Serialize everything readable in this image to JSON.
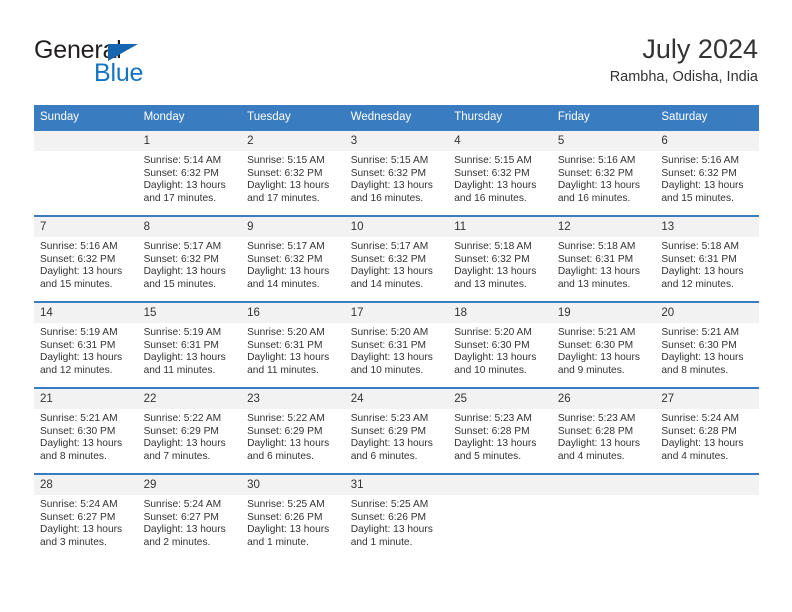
{
  "brand": {
    "name_part1": "General",
    "name_part2": "Blue"
  },
  "header": {
    "title": "July 2024",
    "subtitle": "Rambha, Odisha, India"
  },
  "colors": {
    "header_blue": "#3a7cc0",
    "brand_blue": "#1474c4",
    "daynum_band": "#f2f2f2",
    "text": "#333333"
  },
  "weekday_headers": [
    "Sunday",
    "Monday",
    "Tuesday",
    "Wednesday",
    "Thursday",
    "Friday",
    "Saturday"
  ],
  "weeks": [
    [
      {
        "day": "",
        "empty": true,
        "sunrise": "",
        "sunset": "",
        "daylight1": "",
        "daylight2": ""
      },
      {
        "day": "1",
        "sunrise": "Sunrise: 5:14 AM",
        "sunset": "Sunset: 6:32 PM",
        "daylight1": "Daylight: 13 hours",
        "daylight2": "and 17 minutes."
      },
      {
        "day": "2",
        "sunrise": "Sunrise: 5:15 AM",
        "sunset": "Sunset: 6:32 PM",
        "daylight1": "Daylight: 13 hours",
        "daylight2": "and 17 minutes."
      },
      {
        "day": "3",
        "sunrise": "Sunrise: 5:15 AM",
        "sunset": "Sunset: 6:32 PM",
        "daylight1": "Daylight: 13 hours",
        "daylight2": "and 16 minutes."
      },
      {
        "day": "4",
        "sunrise": "Sunrise: 5:15 AM",
        "sunset": "Sunset: 6:32 PM",
        "daylight1": "Daylight: 13 hours",
        "daylight2": "and 16 minutes."
      },
      {
        "day": "5",
        "sunrise": "Sunrise: 5:16 AM",
        "sunset": "Sunset: 6:32 PM",
        "daylight1": "Daylight: 13 hours",
        "daylight2": "and 16 minutes."
      },
      {
        "day": "6",
        "sunrise": "Sunrise: 5:16 AM",
        "sunset": "Sunset: 6:32 PM",
        "daylight1": "Daylight: 13 hours",
        "daylight2": "and 15 minutes."
      }
    ],
    [
      {
        "day": "7",
        "sunrise": "Sunrise: 5:16 AM",
        "sunset": "Sunset: 6:32 PM",
        "daylight1": "Daylight: 13 hours",
        "daylight2": "and 15 minutes."
      },
      {
        "day": "8",
        "sunrise": "Sunrise: 5:17 AM",
        "sunset": "Sunset: 6:32 PM",
        "daylight1": "Daylight: 13 hours",
        "daylight2": "and 15 minutes."
      },
      {
        "day": "9",
        "sunrise": "Sunrise: 5:17 AM",
        "sunset": "Sunset: 6:32 PM",
        "daylight1": "Daylight: 13 hours",
        "daylight2": "and 14 minutes."
      },
      {
        "day": "10",
        "sunrise": "Sunrise: 5:17 AM",
        "sunset": "Sunset: 6:32 PM",
        "daylight1": "Daylight: 13 hours",
        "daylight2": "and 14 minutes."
      },
      {
        "day": "11",
        "sunrise": "Sunrise: 5:18 AM",
        "sunset": "Sunset: 6:32 PM",
        "daylight1": "Daylight: 13 hours",
        "daylight2": "and 13 minutes."
      },
      {
        "day": "12",
        "sunrise": "Sunrise: 5:18 AM",
        "sunset": "Sunset: 6:31 PM",
        "daylight1": "Daylight: 13 hours",
        "daylight2": "and 13 minutes."
      },
      {
        "day": "13",
        "sunrise": "Sunrise: 5:18 AM",
        "sunset": "Sunset: 6:31 PM",
        "daylight1": "Daylight: 13 hours",
        "daylight2": "and 12 minutes."
      }
    ],
    [
      {
        "day": "14",
        "sunrise": "Sunrise: 5:19 AM",
        "sunset": "Sunset: 6:31 PM",
        "daylight1": "Daylight: 13 hours",
        "daylight2": "and 12 minutes."
      },
      {
        "day": "15",
        "sunrise": "Sunrise: 5:19 AM",
        "sunset": "Sunset: 6:31 PM",
        "daylight1": "Daylight: 13 hours",
        "daylight2": "and 11 minutes."
      },
      {
        "day": "16",
        "sunrise": "Sunrise: 5:20 AM",
        "sunset": "Sunset: 6:31 PM",
        "daylight1": "Daylight: 13 hours",
        "daylight2": "and 11 minutes."
      },
      {
        "day": "17",
        "sunrise": "Sunrise: 5:20 AM",
        "sunset": "Sunset: 6:31 PM",
        "daylight1": "Daylight: 13 hours",
        "daylight2": "and 10 minutes."
      },
      {
        "day": "18",
        "sunrise": "Sunrise: 5:20 AM",
        "sunset": "Sunset: 6:30 PM",
        "daylight1": "Daylight: 13 hours",
        "daylight2": "and 10 minutes."
      },
      {
        "day": "19",
        "sunrise": "Sunrise: 5:21 AM",
        "sunset": "Sunset: 6:30 PM",
        "daylight1": "Daylight: 13 hours",
        "daylight2": "and 9 minutes."
      },
      {
        "day": "20",
        "sunrise": "Sunrise: 5:21 AM",
        "sunset": "Sunset: 6:30 PM",
        "daylight1": "Daylight: 13 hours",
        "daylight2": "and 8 minutes."
      }
    ],
    [
      {
        "day": "21",
        "sunrise": "Sunrise: 5:21 AM",
        "sunset": "Sunset: 6:30 PM",
        "daylight1": "Daylight: 13 hours",
        "daylight2": "and 8 minutes."
      },
      {
        "day": "22",
        "sunrise": "Sunrise: 5:22 AM",
        "sunset": "Sunset: 6:29 PM",
        "daylight1": "Daylight: 13 hours",
        "daylight2": "and 7 minutes."
      },
      {
        "day": "23",
        "sunrise": "Sunrise: 5:22 AM",
        "sunset": "Sunset: 6:29 PM",
        "daylight1": "Daylight: 13 hours",
        "daylight2": "and 6 minutes."
      },
      {
        "day": "24",
        "sunrise": "Sunrise: 5:23 AM",
        "sunset": "Sunset: 6:29 PM",
        "daylight1": "Daylight: 13 hours",
        "daylight2": "and 6 minutes."
      },
      {
        "day": "25",
        "sunrise": "Sunrise: 5:23 AM",
        "sunset": "Sunset: 6:28 PM",
        "daylight1": "Daylight: 13 hours",
        "daylight2": "and 5 minutes."
      },
      {
        "day": "26",
        "sunrise": "Sunrise: 5:23 AM",
        "sunset": "Sunset: 6:28 PM",
        "daylight1": "Daylight: 13 hours",
        "daylight2": "and 4 minutes."
      },
      {
        "day": "27",
        "sunrise": "Sunrise: 5:24 AM",
        "sunset": "Sunset: 6:28 PM",
        "daylight1": "Daylight: 13 hours",
        "daylight2": "and 4 minutes."
      }
    ],
    [
      {
        "day": "28",
        "sunrise": "Sunrise: 5:24 AM",
        "sunset": "Sunset: 6:27 PM",
        "daylight1": "Daylight: 13 hours",
        "daylight2": "and 3 minutes."
      },
      {
        "day": "29",
        "sunrise": "Sunrise: 5:24 AM",
        "sunset": "Sunset: 6:27 PM",
        "daylight1": "Daylight: 13 hours",
        "daylight2": "and 2 minutes."
      },
      {
        "day": "30",
        "sunrise": "Sunrise: 5:25 AM",
        "sunset": "Sunset: 6:26 PM",
        "daylight1": "Daylight: 13 hours",
        "daylight2": "and 1 minute."
      },
      {
        "day": "31",
        "sunrise": "Sunrise: 5:25 AM",
        "sunset": "Sunset: 6:26 PM",
        "daylight1": "Daylight: 13 hours",
        "daylight2": "and 1 minute."
      },
      {
        "day": "",
        "empty": true,
        "sunrise": "",
        "sunset": "",
        "daylight1": "",
        "daylight2": ""
      },
      {
        "day": "",
        "empty": true,
        "sunrise": "",
        "sunset": "",
        "daylight1": "",
        "daylight2": ""
      },
      {
        "day": "",
        "empty": true,
        "sunrise": "",
        "sunset": "",
        "daylight1": "",
        "daylight2": ""
      }
    ]
  ]
}
